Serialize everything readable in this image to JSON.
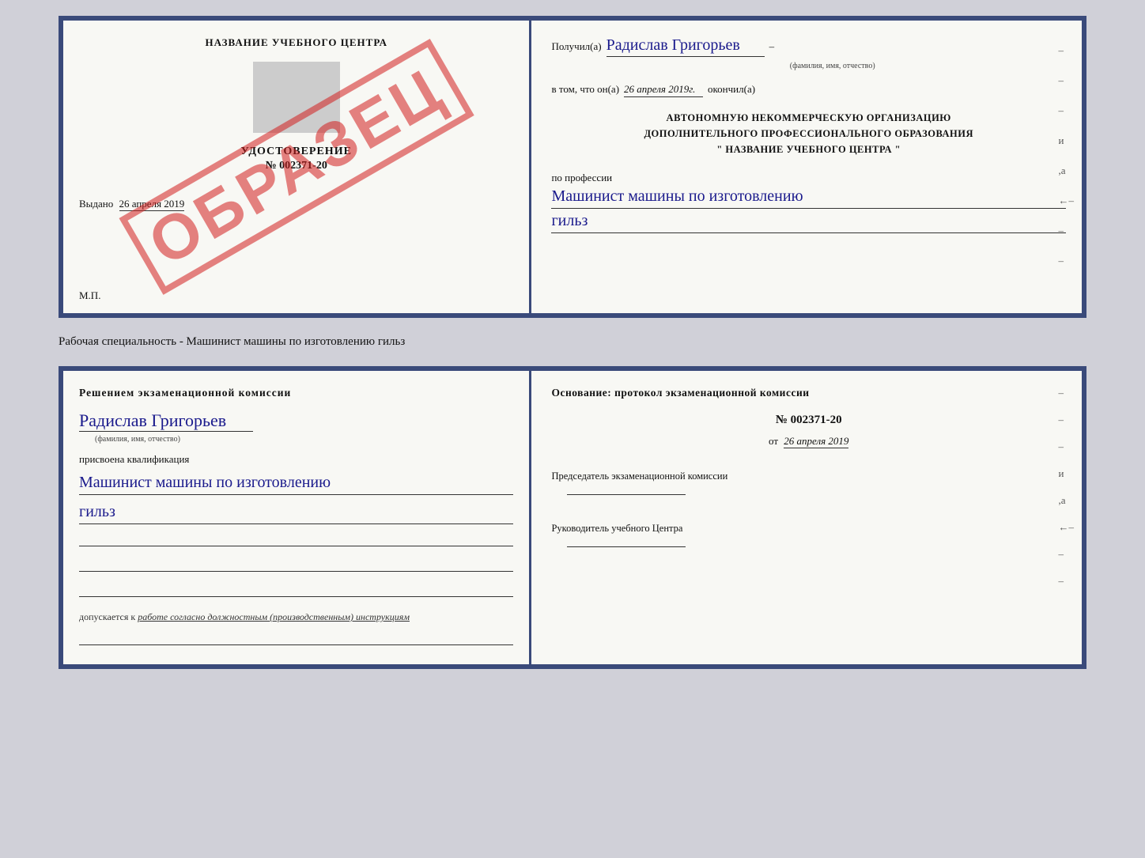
{
  "doc1": {
    "left": {
      "cert_title": "НАЗВАНИЕ УЧЕБНОГО ЦЕНТРА",
      "cert_subtitle": "УДОСТОВЕРЕНИЕ",
      "cert_number": "№ 002371-20",
      "cert_issued_label": "Выдано",
      "cert_issued_date": "26 апреля 2019",
      "cert_mp": "М.П.",
      "watermark": "ОБРАЗЕЦ"
    },
    "right": {
      "received_label": "Получил(а)",
      "received_name": "Радислав Григорьев",
      "name_subtext": "(фамилия, имя, отчество)",
      "in_that_label": "в том, что он(а)",
      "date_value": "26 апреля 2019г.",
      "completed_label": "окончил(а)",
      "org_line1": "АВТОНОМНУЮ НЕКОММЕРЧЕСКУЮ ОРГАНИЗАЦИЮ",
      "org_line2": "ДОПОЛНИТЕЛЬНОГО ПРОФЕССИОНАЛЬНОГО ОБРАЗОВАНИЯ",
      "org_line3": "\"  НАЗВАНИЕ УЧЕБНОГО ЦЕНТРА  \"",
      "profession_label": "по профессии",
      "profession_cursive1": "Машинист машины по изготовлению",
      "profession_cursive2": "гильз",
      "dashes": [
        "-",
        "-",
        "-",
        "и",
        "а",
        "←",
        "-",
        "-"
      ]
    }
  },
  "divider_label": "Рабочая специальность - Машинист машины по изготовлению гильз",
  "doc2": {
    "left": {
      "decision_title": "Решением  экзаменационной  комиссии",
      "person_name": "Радислав Григорьев",
      "person_subtext": "(фамилия, имя, отчество)",
      "qualification_label": "присвоена квалификация",
      "qualification_cursive1": "Машинист машины по изготовлению",
      "qualification_cursive2": "гильз",
      "допускается_label": "допускается к",
      "допускается_value": "работе согласно должностным (производственным) инструкциям"
    },
    "right": {
      "basis_title": "Основание: протокол экзаменационной  комиссии",
      "protocol_number": "№  002371-20",
      "date_prefix": "от",
      "date_value": "26 апреля 2019",
      "chairman_label": "Председатель экзаменационной комиссии",
      "director_label": "Руководитель учебного Центра",
      "dashes": [
        "-",
        "-",
        "-",
        "и",
        "а",
        "←",
        "-",
        "-"
      ]
    }
  }
}
